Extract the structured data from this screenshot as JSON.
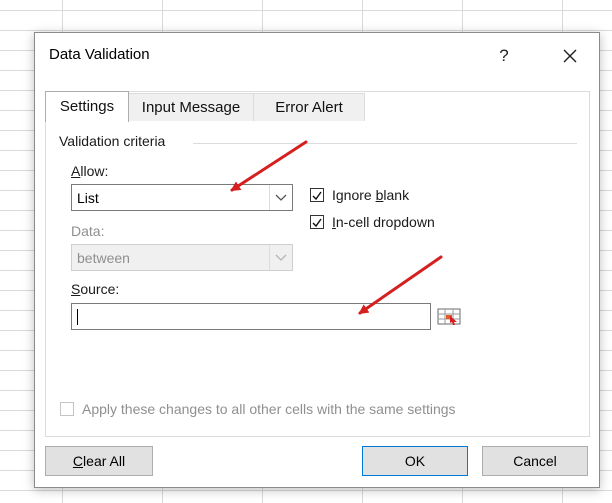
{
  "dialog": {
    "title": "Data Validation",
    "help_label": "?",
    "close_icon": "close-icon"
  },
  "tabs": [
    {
      "label": "Settings",
      "active": true
    },
    {
      "label": "Input Message",
      "active": false
    },
    {
      "label": "Error Alert",
      "active": false
    }
  ],
  "criteria": {
    "section_label": "Validation criteria",
    "allow_label_first": "A",
    "allow_label_rest": "llow:",
    "allow_value": "List",
    "data_label": "Data:",
    "data_value": "between",
    "source_label_first": "S",
    "source_label_rest": "ource:",
    "source_value": ""
  },
  "checkboxes": {
    "ignore_blank_pre": "Ignore ",
    "ignore_blank_key": "b",
    "ignore_blank_post": "lank",
    "ignore_blank_checked": true,
    "in_cell_key": "I",
    "in_cell_post": "n-cell dropdown",
    "in_cell_checked": true,
    "apply_all_label": "Apply these changes to all other cells with the same settings",
    "apply_all_checked": false
  },
  "buttons": {
    "clear_key": "C",
    "clear_rest": "lear All",
    "ok": "OK",
    "cancel": "Cancel"
  },
  "colors": {
    "annotation_arrow": "#d61f1f",
    "default_button_border": "#0078d7"
  }
}
